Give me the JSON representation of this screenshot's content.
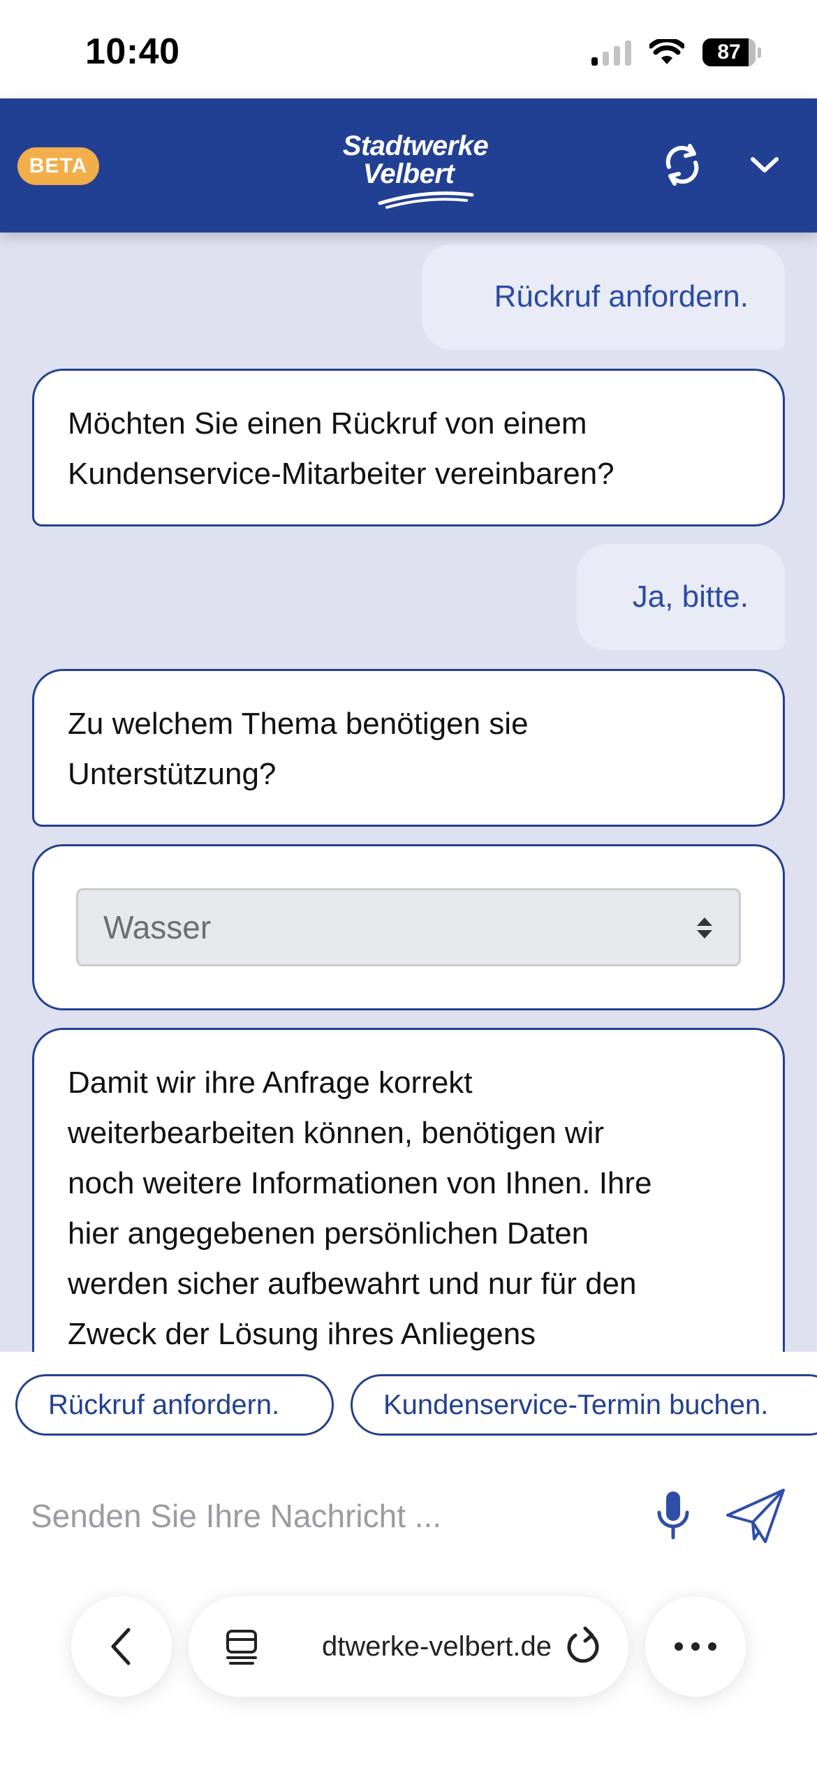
{
  "status_bar": {
    "time": "10:40",
    "battery": "87"
  },
  "header": {
    "badge": "BETA",
    "logo_line1": "Stadtwerke",
    "logo_line2": "Velbert",
    "brand_color": "#224093",
    "badge_color": "#f2ae4a"
  },
  "icons": {
    "refresh": "refresh-icon",
    "collapse": "chevron-down-icon",
    "mic": "microphone-icon",
    "send": "paper-plane-icon",
    "back": "chevron-left-icon",
    "tabs": "tabs-icon",
    "reload": "reload-icon",
    "more": "more-icon"
  },
  "chat": {
    "messages": [
      {
        "from": "user",
        "text": "Rückruf anfordern."
      },
      {
        "from": "bot",
        "lines": [
          "Möchten Sie einen Rückruf von einem",
          "Kundenservice-Mitarbeiter vereinbaren?"
        ]
      },
      {
        "from": "user",
        "text": "Ja, bitte."
      },
      {
        "from": "bot",
        "lines": [
          "Zu welchem Thema benötigen sie",
          "Unterstützung?"
        ]
      },
      {
        "from": "bot",
        "lines": [
          "Damit wir ihre Anfrage korrekt",
          "weiterbearbeiten können, benötigen wir",
          "noch weitere Informationen von Ihnen. Ihre",
          "hier angegebenen persönlichen Daten",
          "werden sicher aufbewahrt und nur für den",
          "Zweck der Lösung ihres Anliegens"
        ]
      }
    ],
    "topic_select": {
      "value": "Wasser"
    }
  },
  "quick_replies": [
    "Rückruf anfordern.",
    "Kundenservice-Termin buchen."
  ],
  "input": {
    "placeholder": "Senden Sie Ihre Nachricht ..."
  },
  "browser": {
    "url": "dtwerke-velbert.de"
  }
}
